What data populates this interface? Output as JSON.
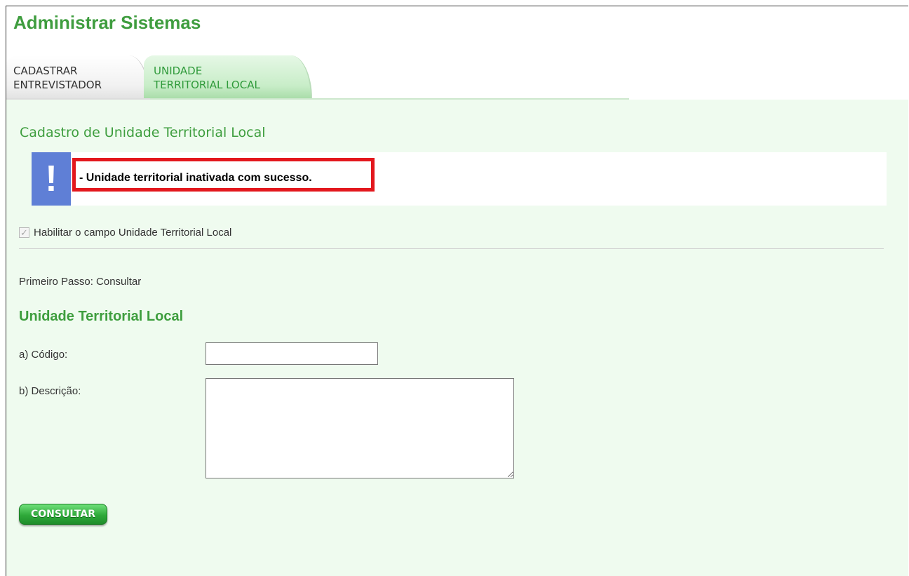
{
  "app": {
    "title": "Administrar Sistemas"
  },
  "tabs": [
    {
      "line1": "CADASTRAR",
      "line2": "ENTREVISTADOR",
      "active": false
    },
    {
      "line1": "UNIDADE",
      "line2": "TERRITORIAL LOCAL",
      "active": true
    }
  ],
  "section": {
    "title": "Cadastro de Unidade Territorial Local"
  },
  "message": {
    "icon": "!",
    "text": "- Unidade territorial inativada com sucesso."
  },
  "checkbox": {
    "label": "Habilitar o campo Unidade Territorial Local",
    "checked": true
  },
  "step": {
    "text": "Primeiro Passo: Consultar"
  },
  "form": {
    "title": "Unidade Territorial Local",
    "codigo_label": "a) Código:",
    "codigo_value": "",
    "descricao_label": "b) Descrição:",
    "descricao_value": ""
  },
  "button": {
    "label": "CONSULTAR"
  },
  "colors": {
    "accent": "#3e9e3e",
    "panel_bg": "#effbef",
    "alert_border": "#e3171d",
    "info_icon": "#5f7fd6"
  }
}
